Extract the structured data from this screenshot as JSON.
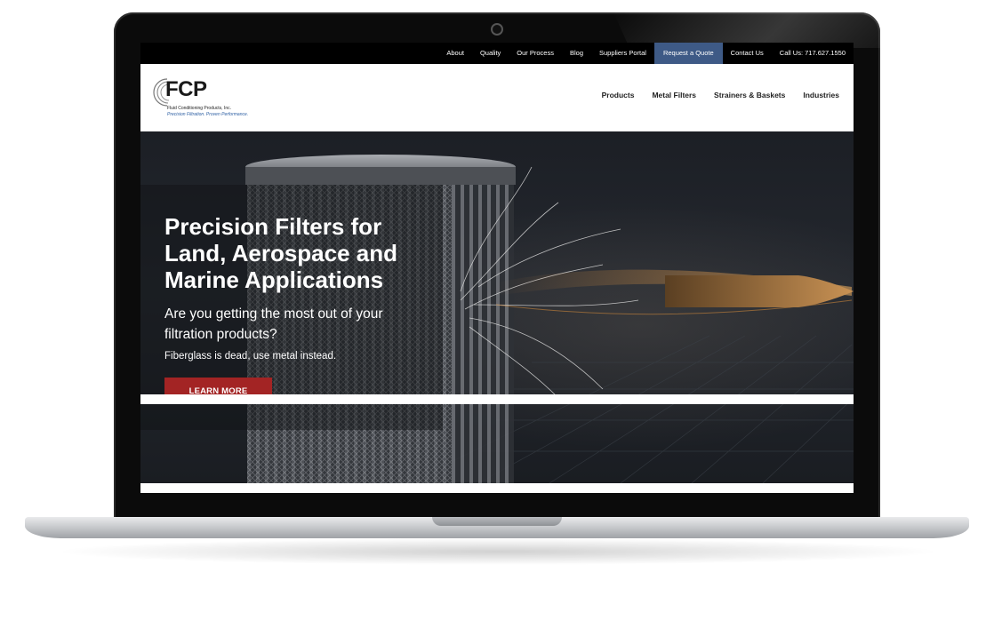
{
  "top_nav": {
    "items": [
      "About",
      "Quality",
      "Our Process",
      "Blog",
      "Suppliers Portal",
      "Request a Quote",
      "Contact Us",
      "Call Us: 717.627.1550"
    ]
  },
  "logo": {
    "name": "FCP",
    "company": "Fluid Conditioning Products, Inc.",
    "tagline": "Precision Filtration. Proven Performance."
  },
  "main_nav": {
    "items": [
      "Products",
      "Metal Filters",
      "Strainers & Baskets",
      "Industries"
    ]
  },
  "hero": {
    "headline": "Precision Filters for Land, Aerospace and Marine Applications",
    "subheadline": "Are you getting the most out of your filtration products?",
    "tagline": "Fiberglass is dead, use metal instead.",
    "cta_label": "LEARN MORE"
  },
  "colors": {
    "accent_quote": "#3e5a86",
    "cta": "#a32424",
    "topbar": "#000000"
  }
}
